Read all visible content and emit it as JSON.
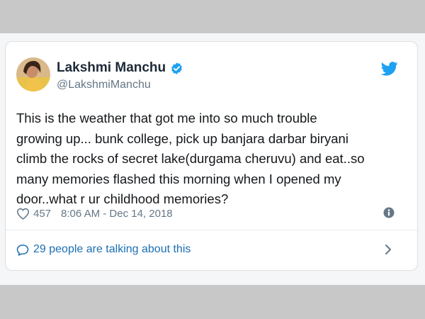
{
  "tweet": {
    "author_name": "Lakshmi Manchu",
    "author_handle": "@LakshmiManchu",
    "text_lines": [
      "This is the weather that got me into so much trouble",
      "growing up... bunk college, pick up banjara darbar biryani",
      "climb the rocks of secret lake(durgama cheruvu) and eat..so",
      "many memories flashed this morning when I opened my",
      "door..what r ur childhood memories?"
    ],
    "likes": "457",
    "timestamp": "8:06 AM - Dec 14, 2018",
    "talking": "29 people are talking about this"
  },
  "colors": {
    "twitter_blue": "#1da1f2",
    "link_blue": "#1b6fb3",
    "text_dark": "#14171a",
    "text_gray": "#657786",
    "outer_gray": "#c8c8c8"
  },
  "icons": {
    "verified": "verified-badge-icon",
    "brand": "twitter-bird-icon",
    "like": "heart-icon",
    "info": "info-icon",
    "reply": "speech-bubble-icon",
    "more": "chevron-right-icon"
  }
}
